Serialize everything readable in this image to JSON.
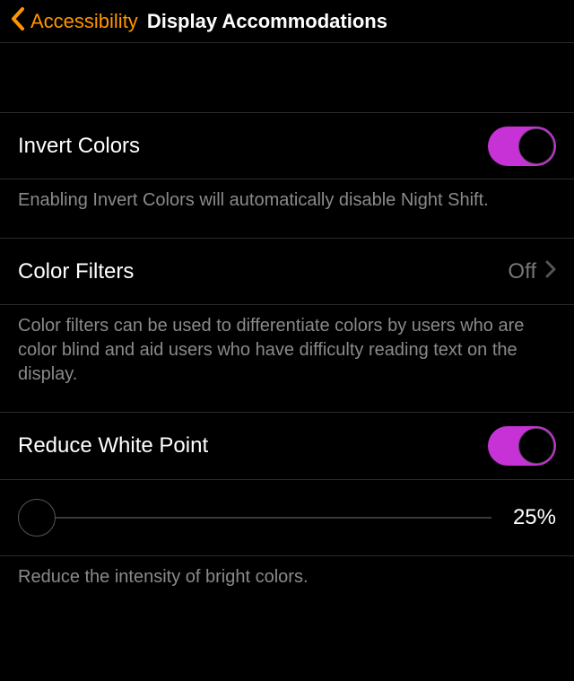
{
  "header": {
    "back_label": "Accessibility",
    "title": "Display Accommodations"
  },
  "invert": {
    "label": "Invert Colors",
    "footer": "Enabling Invert Colors will automatically disable Night Shift."
  },
  "filters": {
    "label": "Color Filters",
    "value": "Off",
    "footer": "Color filters can be used to differentiate colors by users who are color blind and aid users who have difficulty reading text on the display."
  },
  "rwp": {
    "label": "Reduce White Point",
    "slider_value": "25%",
    "footer": "Reduce the intensity of bright colors."
  },
  "colors": {
    "accent": "#ff9500",
    "toggle_on": "#c732d6"
  }
}
